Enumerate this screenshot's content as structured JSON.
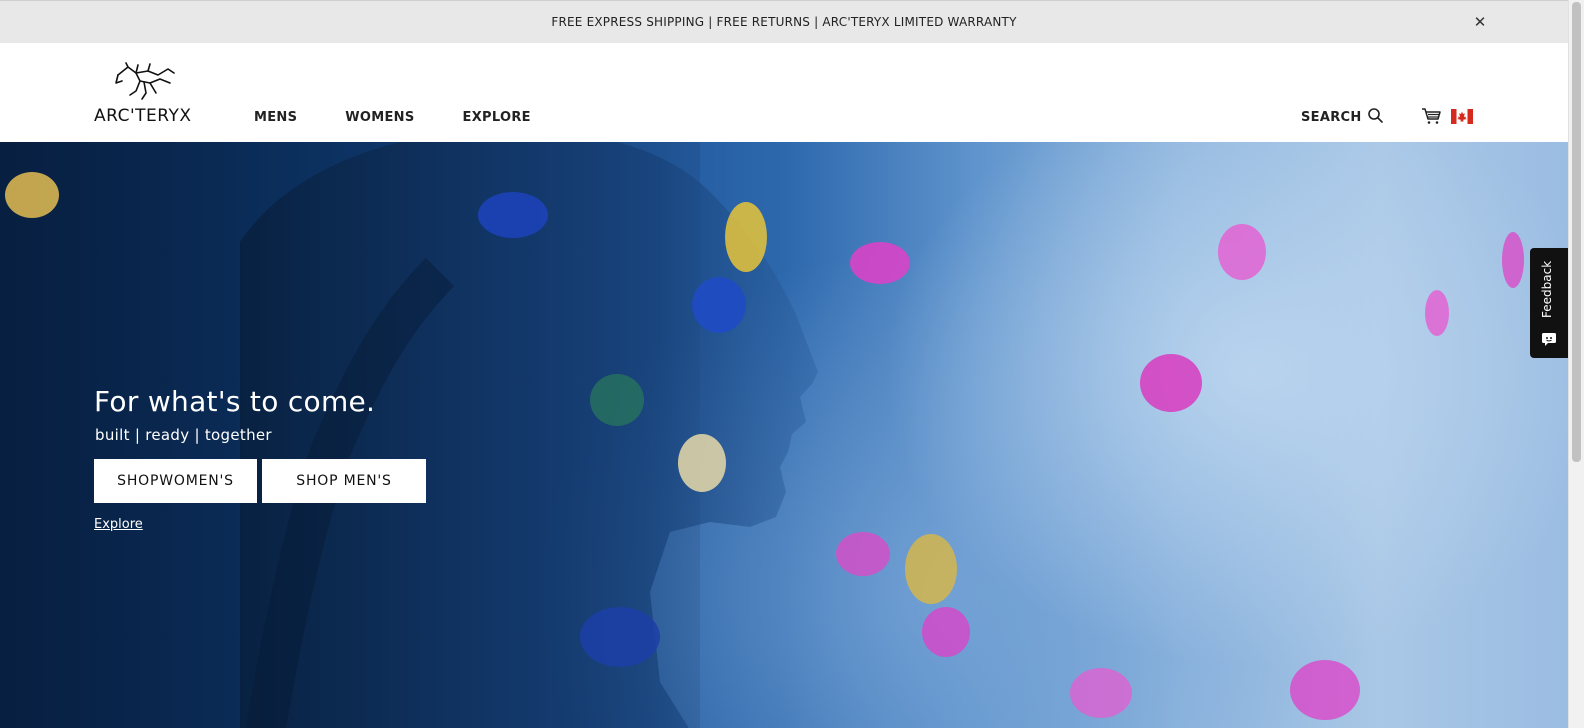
{
  "promo": {
    "text": "FREE EXPRESS SHIPPING  |  FREE RETURNS   |  ARC'TERYX LIMITED WARRANTY",
    "close_icon": "close-icon"
  },
  "header": {
    "logo_text": "ARC'TERYX",
    "nav": [
      {
        "label": "MENS"
      },
      {
        "label": "WOMENS"
      },
      {
        "label": "EXPLORE"
      }
    ],
    "search_label": "SEARCH",
    "icons": [
      "search-icon",
      "cart-icon",
      "canada-flag-icon"
    ]
  },
  "hero": {
    "title": "For what's to come.",
    "subtitle": "built | ready | together",
    "shop_women_label": "SHOPWOMEN'S",
    "shop_men_label": "SHOP MEN'S",
    "explore_label": "Explore"
  },
  "feedback": {
    "label": "Feedback",
    "icon": "chat-icon"
  },
  "colors": {
    "promo_bg": "#e8e8e8",
    "hero_dark": "#0a2c57",
    "hero_light": "#a9c7e6",
    "hold_magenta": "#e03fc8",
    "feedback_bg": "#111111"
  }
}
